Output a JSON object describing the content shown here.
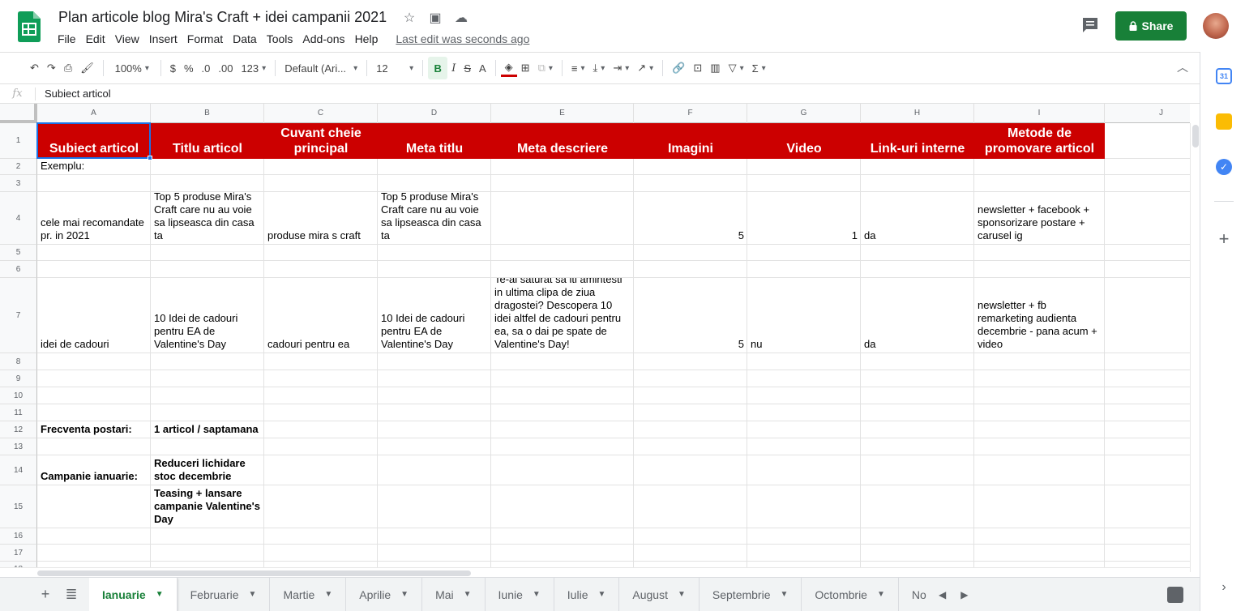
{
  "doc": {
    "title": "Plan articole blog Mira's Craft + idei campanii 2021",
    "menus": [
      "File",
      "Edit",
      "View",
      "Insert",
      "Format",
      "Data",
      "Tools",
      "Add-ons",
      "Help"
    ],
    "last_edit": "Last edit was seconds ago",
    "share_label": "Share"
  },
  "toolbar": {
    "zoom": "100%",
    "currency": "$",
    "percent": "%",
    "dec_less": ".0",
    "dec_more": ".00",
    "more_formats": "123",
    "font": "Default (Ari...",
    "font_size": "12",
    "bold": "B",
    "italic": "I",
    "strike": "S",
    "text_color": "A"
  },
  "formula": {
    "fx": "fx",
    "value": "Subiect articol"
  },
  "columns": [
    {
      "id": "A",
      "w": 140
    },
    {
      "id": "B",
      "w": 140
    },
    {
      "id": "C",
      "w": 140
    },
    {
      "id": "D",
      "w": 140
    },
    {
      "id": "E",
      "w": 176
    },
    {
      "id": "F",
      "w": 140
    },
    {
      "id": "G",
      "w": 140
    },
    {
      "id": "H",
      "w": 140
    },
    {
      "id": "I",
      "w": 161
    },
    {
      "id": "J",
      "w": 140
    }
  ],
  "rows": [
    {
      "n": "1",
      "h": 44
    },
    {
      "n": "2",
      "h": 20
    },
    {
      "n": "3",
      "h": 21
    },
    {
      "n": "4",
      "h": 65
    },
    {
      "n": "5",
      "h": 20
    },
    {
      "n": "6",
      "h": 21
    },
    {
      "n": "7",
      "h": 93
    },
    {
      "n": "8",
      "h": 21
    },
    {
      "n": "9",
      "h": 21
    },
    {
      "n": "10",
      "h": 21
    },
    {
      "n": "11",
      "h": 21
    },
    {
      "n": "12",
      "h": 21
    },
    {
      "n": "13",
      "h": 21
    },
    {
      "n": "14",
      "h": 37
    },
    {
      "n": "15",
      "h": 53
    },
    {
      "n": "16",
      "h": 20
    },
    {
      "n": "17",
      "h": 21
    },
    {
      "n": "18",
      "h": 20
    }
  ],
  "header_row": [
    "Subiect articol",
    "Titlu articol",
    "Cuvant cheie principal",
    "Meta titlu",
    "Meta descriere",
    "Imagini",
    "Video",
    "Link-uri interne",
    "Metode de promovare articol"
  ],
  "cells": [
    {
      "r": 1,
      "c": 0,
      "v": "Exemplu:"
    },
    {
      "r": 3,
      "c": 0,
      "v": "cele mai recomandate pr. in 2021"
    },
    {
      "r": 3,
      "c": 1,
      "v": "Top 5 produse Mira's Craft care nu au voie sa lipseasca din casa ta"
    },
    {
      "r": 3,
      "c": 2,
      "v": "produse mira s craft"
    },
    {
      "r": 3,
      "c": 3,
      "v": "Top 5 produse Mira's Craft care nu au voie sa lipseasca din casa ta"
    },
    {
      "r": 3,
      "c": 5,
      "v": "5",
      "num": true
    },
    {
      "r": 3,
      "c": 6,
      "v": "1",
      "num": true
    },
    {
      "r": 3,
      "c": 7,
      "v": "da"
    },
    {
      "r": 3,
      "c": 8,
      "v": "newsletter + facebook + sponsorizare postare + carusel ig"
    },
    {
      "r": 6,
      "c": 0,
      "v": "idei de cadouri"
    },
    {
      "r": 6,
      "c": 1,
      "v": "10 Idei de cadouri pentru EA de Valentine's Day"
    },
    {
      "r": 6,
      "c": 2,
      "v": "cadouri pentru ea"
    },
    {
      "r": 6,
      "c": 3,
      "v": "10 Idei de cadouri pentru EA de Valentine's Day"
    },
    {
      "r": 6,
      "c": 4,
      "v": "Te-ai saturat sa iti amintesti in ultima clipa de ziua dragostei? Descopera 10 idei altfel de cadouri pentru ea, sa o dai pe spate de Valentine's Day!"
    },
    {
      "r": 6,
      "c": 5,
      "v": "5",
      "num": true
    },
    {
      "r": 6,
      "c": 6,
      "v": "nu"
    },
    {
      "r": 6,
      "c": 7,
      "v": "da"
    },
    {
      "r": 6,
      "c": 8,
      "v": "newsletter + fb remarketing audienta decembrie - pana acum + video"
    },
    {
      "r": 11,
      "c": 0,
      "v": "Frecventa postari:",
      "bold": true
    },
    {
      "r": 11,
      "c": 1,
      "v": "1 articol / saptamana",
      "bold": true
    },
    {
      "r": 13,
      "c": 0,
      "v": "Campanie ianuarie:",
      "bold": true
    },
    {
      "r": 13,
      "c": 1,
      "v": "Reduceri lichidare stoc decembrie",
      "bold": true
    },
    {
      "r": 14,
      "c": 1,
      "v": "Teasing + lansare campanie Valentine's Day",
      "bold": true
    }
  ],
  "tabs": [
    "Ianuarie",
    "Februarie",
    "Martie",
    "Aprilie",
    "Mai",
    "Iunie",
    "Iulie",
    "August",
    "Septembrie",
    "Octombrie",
    "No"
  ],
  "active_tab": 0,
  "colors": {
    "header_red": "#cc0000",
    "share_green": "#188038",
    "selection_blue": "#1a73e8"
  },
  "side_panel": {
    "calendar_day": "31"
  }
}
